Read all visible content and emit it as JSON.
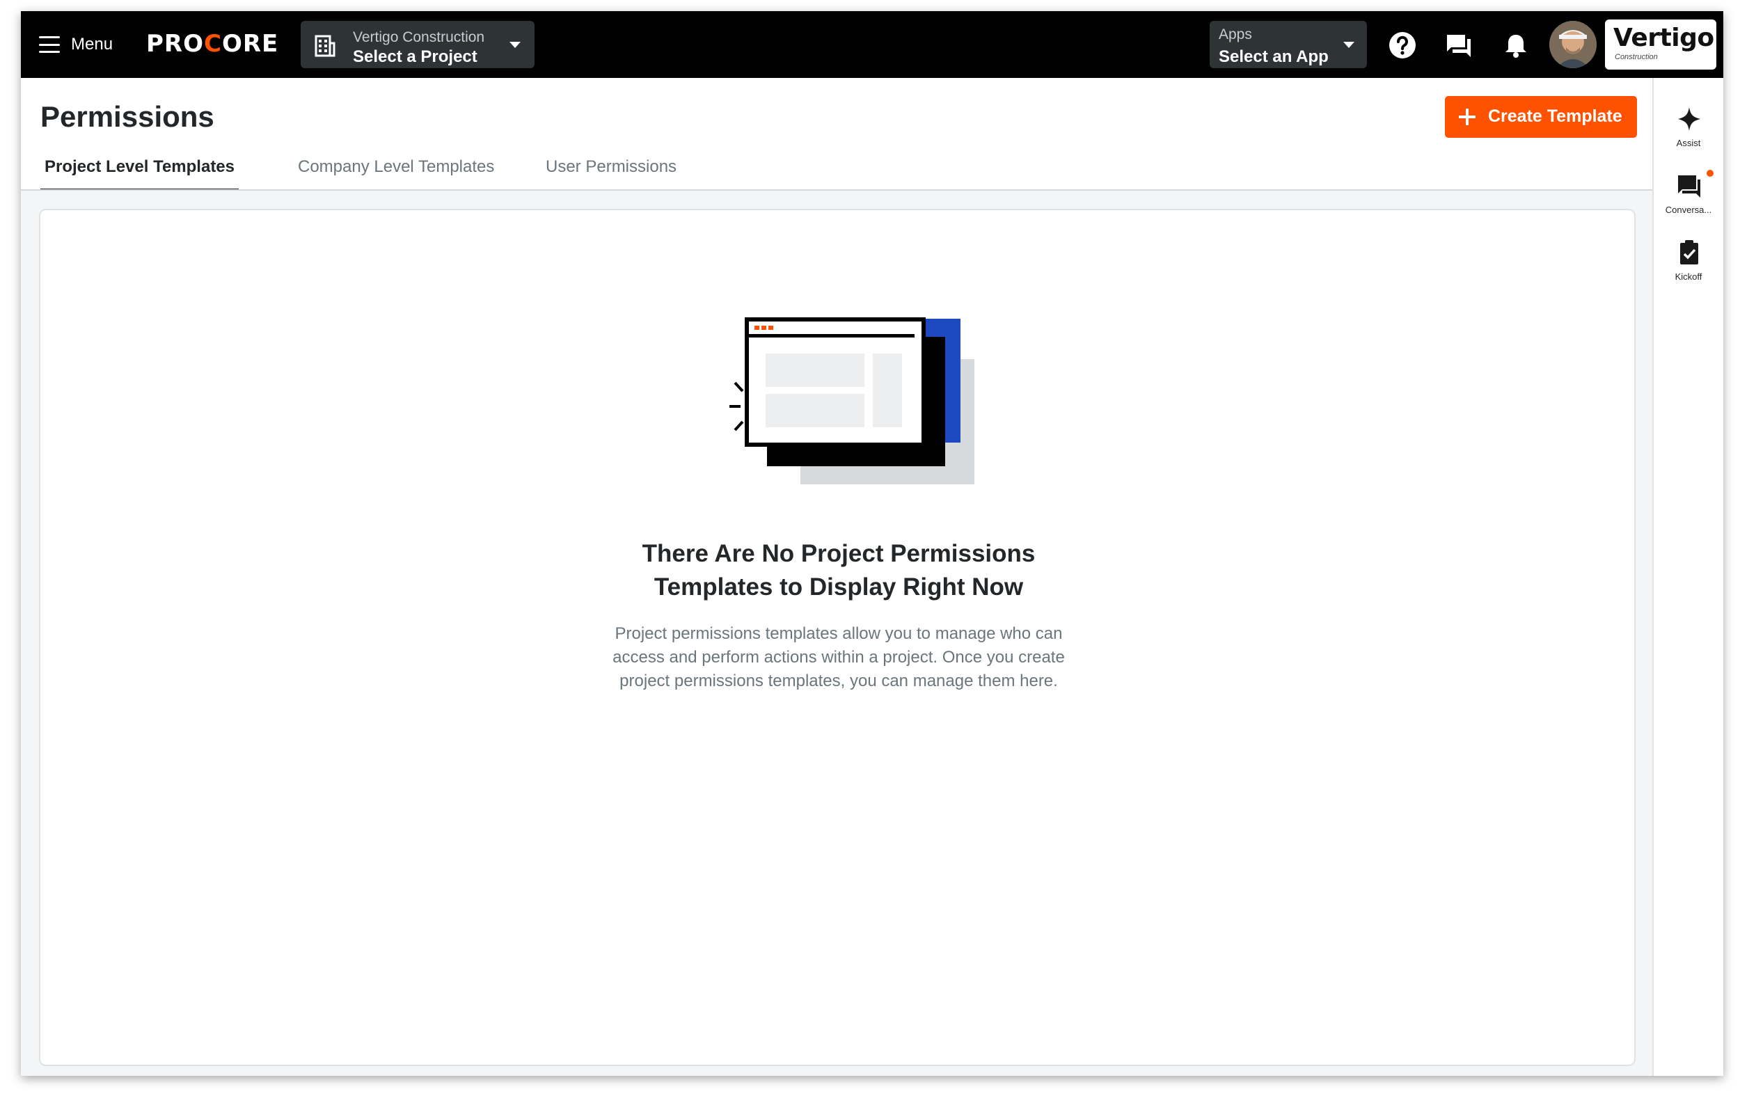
{
  "header": {
    "menu_label": "Menu",
    "logo_text": "PROCORE",
    "project_picker": {
      "company": "Vertigo Construction",
      "label": "Select a Project"
    },
    "app_picker": {
      "small": "Apps",
      "label": "Select an App"
    },
    "company_logo": {
      "name": "Vertigo",
      "sub": "Construction"
    }
  },
  "page": {
    "title": "Permissions",
    "create_button": "Create Template",
    "tabs": [
      {
        "label": "Project Level Templates",
        "active": true
      },
      {
        "label": "Company Level Templates",
        "active": false
      },
      {
        "label": "User Permissions",
        "active": false
      }
    ]
  },
  "empty_state": {
    "title_line1": "There Are No Project Permissions",
    "title_line2": "Templates to Display Right Now",
    "desc_line1": "Project permissions templates allow you to manage who can",
    "desc_line2": "access and perform actions within a project. Once you create",
    "desc_line3": "project permissions templates, you can manage them here."
  },
  "rail": {
    "items": [
      {
        "label": "Assist",
        "icon": "sparkle-icon"
      },
      {
        "label": "Conversa...",
        "icon": "chat-icon"
      },
      {
        "label": "Kickoff",
        "icon": "clipboard-check-icon"
      }
    ]
  },
  "colors": {
    "brand_orange": "#ff5200",
    "nav_bg": "#000000",
    "picker_bg": "#2e3336",
    "illustration_blue": "#1d4ac0"
  }
}
